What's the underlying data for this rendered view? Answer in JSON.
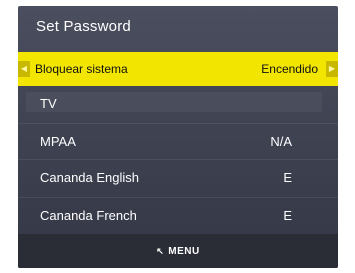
{
  "title": "Set Password",
  "rows": [
    {
      "label": "Bloquear sistema",
      "value": "Encendido"
    },
    {
      "label": "TV",
      "value": ""
    },
    {
      "label": "MPAA",
      "value": "N/A"
    },
    {
      "label": "Cananda  English",
      "value": "E"
    },
    {
      "label": "Cananda  French",
      "value": "E"
    }
  ],
  "footer": {
    "menu_label": "MENU"
  },
  "colors": {
    "highlight": "#f2e600",
    "panel": "#3f4352"
  },
  "icons": {
    "left": "left-arrow-icon",
    "right": "right-arrow-icon",
    "menu": "menu-return-icon"
  }
}
